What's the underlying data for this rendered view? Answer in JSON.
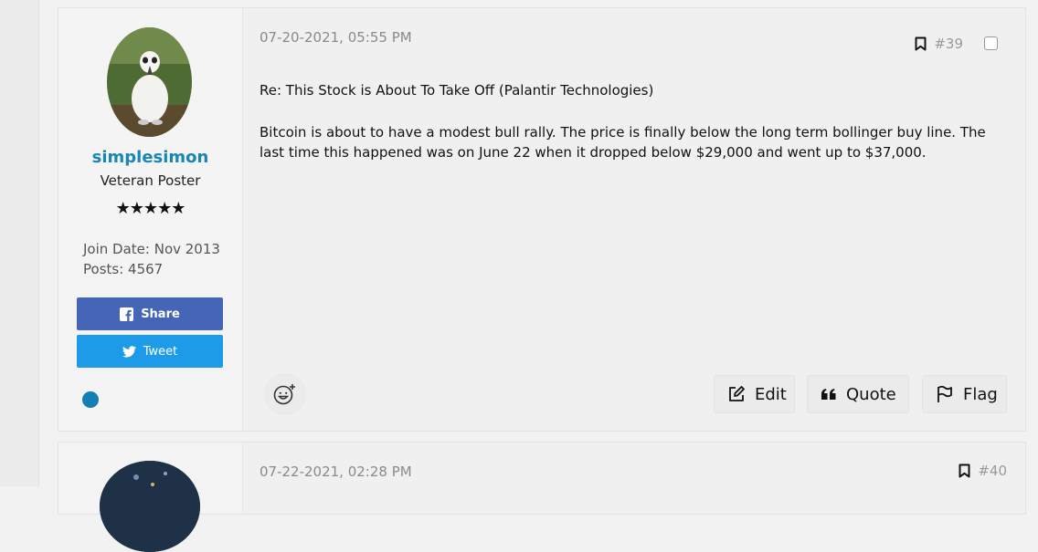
{
  "posts": [
    {
      "date": "07-20-2021, 05:55 PM",
      "number": "#39",
      "author": {
        "username": "simplesimon",
        "title": "Veteran Poster",
        "stars": "★★★★★",
        "join_date": "Join Date: Nov 2013",
        "posts": "Posts: 4567"
      },
      "title": "Re: This Stock is About To Take Off (Palantir Technologies)",
      "body": "Bitcoin is about to have a modest bull rally. The price is finally below the long term bollinger buy line. The last time this happened was on June 22 when it dropped below $29,000 and went up to $37,000.",
      "share_label": "Share",
      "tweet_label": "Tweet",
      "actions": {
        "edit": "Edit",
        "quote": "Quote",
        "flag": "Flag"
      }
    },
    {
      "date": "07-22-2021, 02:28 PM",
      "number": "#40"
    }
  ],
  "colors": {
    "username": "#1a86b3",
    "share_bg": "#4566b6",
    "tweet_bg": "#1d9be8",
    "online": "#1380b5"
  },
  "icons": [
    "bookmark-icon",
    "facebook-icon",
    "twitter-icon",
    "reaction-add-icon",
    "edit-icon",
    "quote-icon",
    "flag-icon"
  ]
}
